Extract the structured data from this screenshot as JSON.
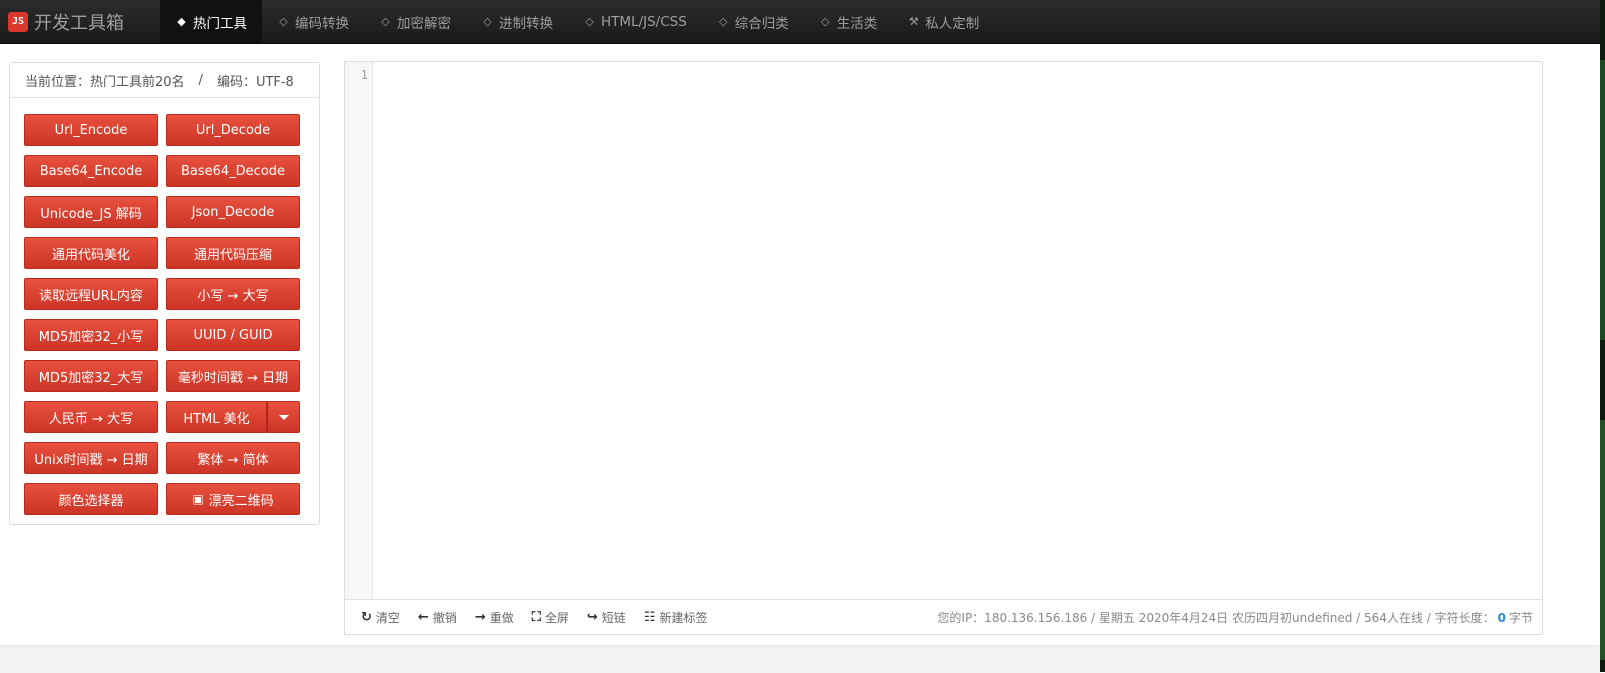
{
  "brand": {
    "logo_text": "JS",
    "title": "开发工具箱"
  },
  "nav": {
    "items": [
      {
        "label": "热门工具",
        "icon": "tag-icon",
        "active": true
      },
      {
        "label": "编码转换",
        "icon": "tag-icon"
      },
      {
        "label": "加密解密",
        "icon": "tag-icon"
      },
      {
        "label": "进制转换",
        "icon": "tag-icon"
      },
      {
        "label": "HTML/JS/CSS",
        "icon": "tag-icon"
      },
      {
        "label": "综合归类",
        "icon": "tag-icon"
      },
      {
        "label": "生活类",
        "icon": "tag-icon"
      },
      {
        "label": "私人定制",
        "icon": "wrench-icon"
      }
    ]
  },
  "panel": {
    "location_label": "当前位置：热门工具前20名",
    "separator": "/",
    "encoding_label": "编码：UTF-8",
    "buttons": [
      [
        "Url_Encode",
        "Url_Decode"
      ],
      [
        "Base64_Encode",
        "Base64_Decode"
      ],
      [
        "Unicode_JS 解码",
        "Json_Decode"
      ],
      [
        "通用代码美化",
        "通用代码压缩"
      ],
      [
        "读取远程URL内容",
        "小写 → 大写"
      ],
      [
        "MD5加密32_小写",
        "UUID / GUID"
      ],
      [
        "MD5加密32_大写",
        "毫秒时间戳 → 日期"
      ],
      [
        "人民币 → 大写",
        "HTML 美化"
      ],
      [
        "Unix时间戳 → 日期",
        "繁体 → 简体"
      ],
      [
        "颜色选择器",
        "漂亮二维码"
      ]
    ]
  },
  "editor": {
    "line_number": "1",
    "tools": [
      {
        "label": "清空",
        "icon": "refresh-icon"
      },
      {
        "label": "撤销",
        "icon": "arrow-left-icon"
      },
      {
        "label": "重做",
        "icon": "arrow-right-icon"
      },
      {
        "label": "全屏",
        "icon": "fullscreen-icon"
      },
      {
        "label": "短链",
        "icon": "share-icon"
      },
      {
        "label": "新建标签",
        "icon": "grid-icon"
      }
    ],
    "status_info": "您的IP：180.136.156.186 / 星期五 2020年4月24日 农历四月初undefined / 564人在线 / 字符长度：",
    "char_count": "0",
    "char_unit": "字节"
  }
}
